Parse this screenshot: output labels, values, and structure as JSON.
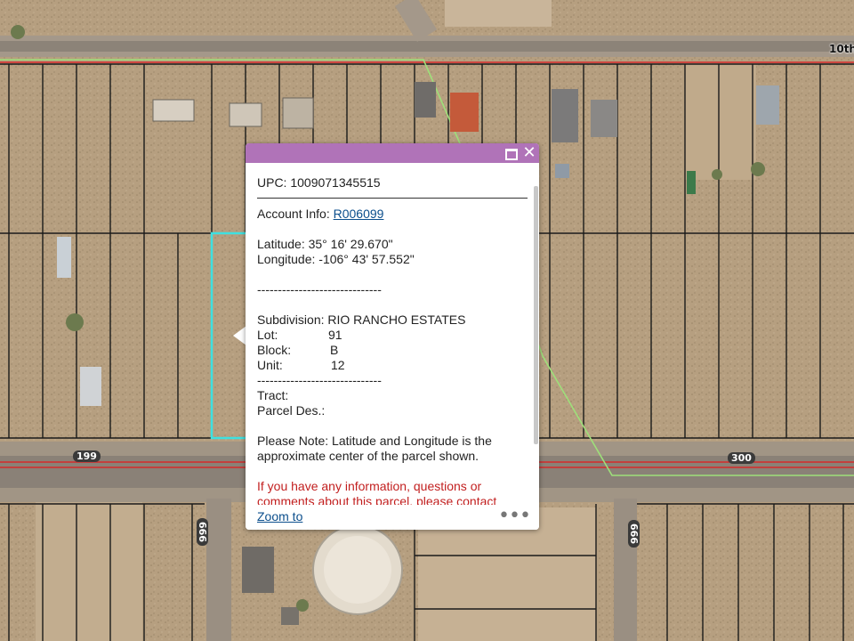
{
  "map": {
    "street_label": "10th",
    "route_labels": [
      "199",
      "300",
      "666",
      "666"
    ]
  },
  "popup": {
    "title": "UPC: 1009071345515",
    "account_label": "Account Info: ",
    "account_link": "R006099",
    "latitude": "Latitude: 35° 16' 29.670\"",
    "longitude": "Longitude: -106° 43' 57.552\"",
    "divider": "------------------------------",
    "subdivision": "Subdivision: RIO RANCHO ESTATES",
    "lot_label": "Lot:",
    "lot_value": "91",
    "block_label": "Block:",
    "block_value": "B",
    "unit_label": "Unit:",
    "unit_value": "12",
    "tract": "Tract:",
    "parcel_des": "Parcel Des.:",
    "note": "Please Note: Latitude and Longitude is the approximate center of the parcel shown.",
    "warning": "If you have any information, questions or comments about this parcel, please contact",
    "zoom_to": "Zoom to"
  }
}
